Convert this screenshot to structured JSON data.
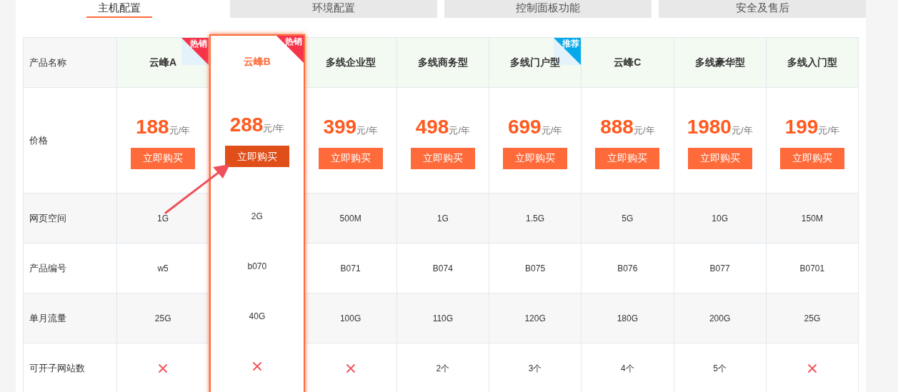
{
  "tabs": [
    {
      "label": "主机配置",
      "selected": true
    },
    {
      "label": "环境配置",
      "selected": false
    },
    {
      "label": "控制面板功能",
      "selected": false
    },
    {
      "label": "安全及售后",
      "selected": false
    }
  ],
  "table": {
    "header_label": "产品名称",
    "price_label": "价格",
    "row_labels": [
      "网页空间",
      "产品编号",
      "单月流量",
      "可开子网站数"
    ],
    "columns": [
      {
        "name": "云峰A",
        "price": "188",
        "unit": "元/年",
        "button": "立即购买",
        "selected": false,
        "badge": {
          "text": "热销",
          "color": "#f5334a"
        },
        "cells": [
          {
            "kind": "text",
            "text": "1G"
          },
          {
            "kind": "text",
            "text": "w5"
          },
          {
            "kind": "text",
            "text": "25G"
          },
          {
            "kind": "cross"
          }
        ]
      },
      {
        "name": "云峰B",
        "price": "288",
        "unit": "元/年",
        "button": "立即购买",
        "selected": true,
        "badge": {
          "text": "热销",
          "color": "#f5334a"
        },
        "cells": [
          {
            "kind": "text",
            "text": "2G"
          },
          {
            "kind": "text",
            "text": "b070"
          },
          {
            "kind": "text",
            "text": "40G"
          },
          {
            "kind": "cross"
          }
        ]
      },
      {
        "name": "多线企业型",
        "price": "399",
        "unit": "元/年",
        "button": "立即购买",
        "selected": false,
        "cells": [
          {
            "kind": "text",
            "text": "500M"
          },
          {
            "kind": "text",
            "text": "B071"
          },
          {
            "kind": "text",
            "text": "100G"
          },
          {
            "kind": "cross"
          }
        ]
      },
      {
        "name": "多线商务型",
        "price": "498",
        "unit": "元/年",
        "button": "立即购买",
        "selected": false,
        "cells": [
          {
            "kind": "text",
            "text": "1G"
          },
          {
            "kind": "text",
            "text": "B074"
          },
          {
            "kind": "text",
            "text": "110G"
          },
          {
            "kind": "text",
            "text": "2个"
          }
        ]
      },
      {
        "name": "多线门户型",
        "price": "699",
        "unit": "元/年",
        "button": "立即购买",
        "selected": false,
        "badge": {
          "text": "推荐",
          "color": "#06a9ec"
        },
        "cells": [
          {
            "kind": "text",
            "text": "1.5G"
          },
          {
            "kind": "text",
            "text": "B075"
          },
          {
            "kind": "text",
            "text": "120G"
          },
          {
            "kind": "text",
            "text": "3个"
          }
        ]
      },
      {
        "name": "云峰C",
        "price": "888",
        "unit": "元/年",
        "button": "立即购买",
        "selected": false,
        "cells": [
          {
            "kind": "text",
            "text": "5G"
          },
          {
            "kind": "text",
            "text": "B076"
          },
          {
            "kind": "text",
            "text": "180G"
          },
          {
            "kind": "text",
            "text": "4个"
          }
        ]
      },
      {
        "name": "多线豪华型",
        "price": "1980",
        "unit": "元/年",
        "button": "立即购买",
        "selected": false,
        "cells": [
          {
            "kind": "text",
            "text": "10G"
          },
          {
            "kind": "text",
            "text": "B077"
          },
          {
            "kind": "text",
            "text": "200G"
          },
          {
            "kind": "text",
            "text": "5个"
          }
        ]
      },
      {
        "name": "多线入门型",
        "price": "199",
        "unit": "元/年",
        "button": "立即购买",
        "selected": false,
        "cells": [
          {
            "kind": "text",
            "text": "150M"
          },
          {
            "kind": "text",
            "text": "B0701"
          },
          {
            "kind": "text",
            "text": "25G"
          },
          {
            "kind": "cross"
          }
        ]
      }
    ]
  }
}
